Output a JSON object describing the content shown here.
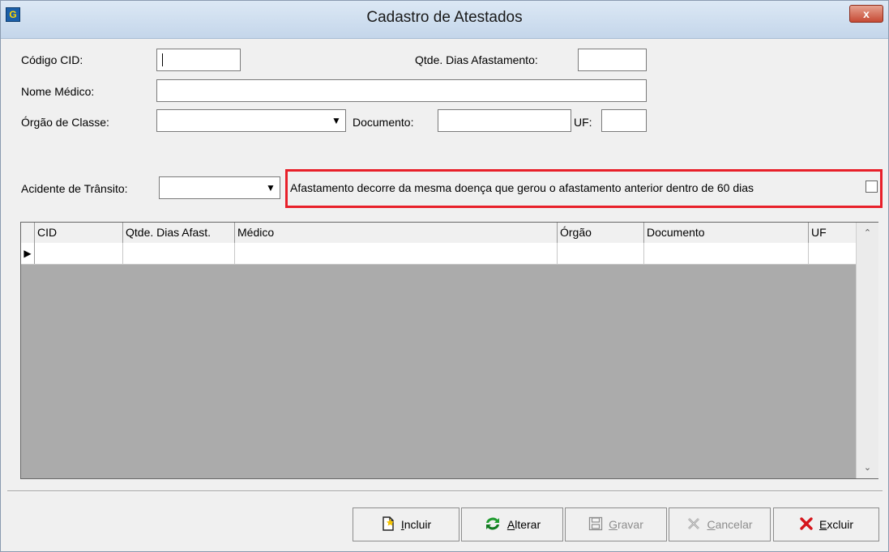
{
  "window": {
    "title": "Cadastro de Atestados",
    "app_icon": "app-logo-icon",
    "close_label": "x"
  },
  "form": {
    "cid_label": "Código CID:",
    "cid_value": "",
    "dias_label": "Qtde. Dias Afastamento:",
    "dias_value": "",
    "medico_label": "Nome Médico:",
    "medico_value": "",
    "orgao_label": "Órgão de Classe:",
    "orgao_value": "",
    "documento_label": "Documento:",
    "documento_value": "",
    "uf_label": "UF:",
    "uf_value": "",
    "acidente_label": "Acidente de Trânsito:",
    "acidente_value": "",
    "afastamento_label": "Afastamento decorre da mesma doença que gerou o afastamento anterior dentro de 60 dias",
    "afastamento_checked": false,
    "highlight_color": "#e8202a"
  },
  "grid": {
    "columns": [
      "CID",
      "Qtde. Dias Afast.",
      "Médico",
      "Órgão",
      "Documento",
      "UF"
    ],
    "rows": [
      [
        "",
        "",
        "",
        "",
        "",
        ""
      ]
    ]
  },
  "buttons": {
    "incluir": {
      "first": "I",
      "rest": "ncluir",
      "icon": "new-document-icon",
      "enabled": true
    },
    "alterar": {
      "first": "A",
      "rest": "lterar",
      "icon": "refresh-icon",
      "enabled": true
    },
    "gravar": {
      "first": "G",
      "rest": "ravar",
      "icon": "save-icon",
      "enabled": false
    },
    "cancelar": {
      "first": "C",
      "rest": "ancelar",
      "icon": "cancel-icon",
      "enabled": false
    },
    "excluir": {
      "first": "E",
      "rest": "xcluir",
      "icon": "delete-icon",
      "enabled": true
    }
  }
}
